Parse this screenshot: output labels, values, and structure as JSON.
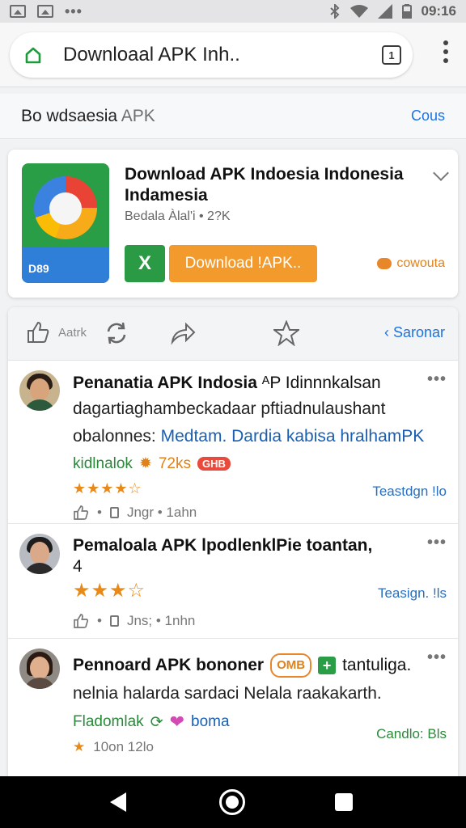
{
  "status_bar": {
    "time": "09:16"
  },
  "browser": {
    "url_text": "Downloaal APK Inh..",
    "tab_count": "1"
  },
  "page_header": {
    "title_main": "Bo wdsaesia",
    "title_muted": "APK",
    "link": "Cous"
  },
  "app_card": {
    "icon_corner_text": "D89",
    "title": "Download APK Indoesia Indonesia Indamesia",
    "subtitle": "Bedala Àlal'i • 2?K",
    "x_button_label": "X",
    "download_button_label": "Download !APK..",
    "extra_label": "cowouta"
  },
  "actions": {
    "like_label": "Aatrk",
    "link": "Saronar",
    "icons": [
      "thumb-up-icon",
      "refresh-icon",
      "share-icon",
      "star-icon"
    ]
  },
  "reviews": [
    {
      "author": "Penanatia APK Indosia",
      "head_extra": "ᴬP Idinnnkalsan",
      "line1": "dagartiaghambeckadaar pftiadnulaushant",
      "line2_plain": "obalonnes:",
      "line2_blue": "Medtam. Dardia kabisa hralhamPK",
      "tag_green": "kidlnalok",
      "tag_orange": "72ks",
      "tag_badge": "GHB",
      "stars": "★★★★☆",
      "meta": "Teastdgn !lo",
      "footer_time": "Jngr • 1ahn"
    },
    {
      "author": "Pemaloala APK lpodlenklPie toantan,",
      "head_line2": "4",
      "stars": "★★★☆",
      "meta": "Teasign. !ls",
      "footer_time": "Jns; • 1nhn"
    },
    {
      "author": "Pennoard APK bononer",
      "pill": "OMB",
      "plus_label": "+",
      "head_extra": "tantuliga.",
      "line1": "nelnia halarda sardaci Nelala raakakarth.",
      "tag_green": "Fladomlak",
      "tag_pink": "boma",
      "meta": "Candlo: Bls",
      "footer_stars": "★",
      "footer_time": "10on 12lo"
    }
  ],
  "colors": {
    "accent_blue": "#1a73e8",
    "download_orange": "#f39a2d",
    "install_green": "#2b9a45",
    "star_orange": "#e88a1a"
  }
}
